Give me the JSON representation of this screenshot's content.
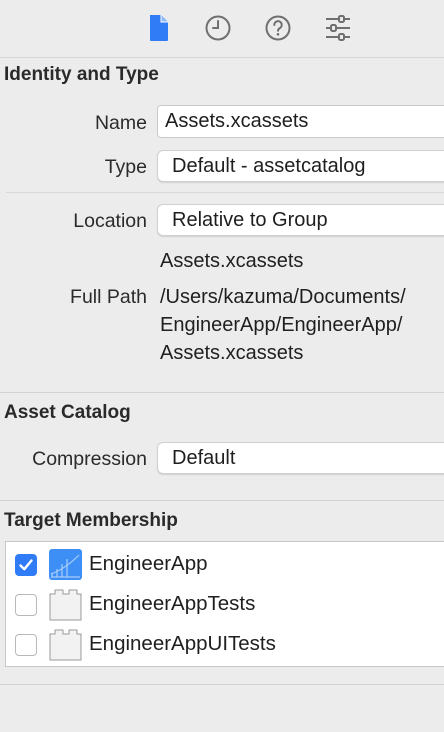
{
  "toolbar": {
    "tabs": [
      {
        "name": "file-inspector",
        "icon": "document-icon",
        "active": true
      },
      {
        "name": "history-inspector",
        "icon": "clock-icon",
        "active": false
      },
      {
        "name": "quick-help",
        "icon": "question-circle-icon",
        "active": false
      },
      {
        "name": "attributes-inspector",
        "icon": "sliders-icon",
        "active": false
      }
    ]
  },
  "identity": {
    "title": "Identity and Type",
    "name_label": "Name",
    "name_value": "Assets.xcassets",
    "type_label": "Type",
    "type_value": "Default - assetcatalog",
    "location_label": "Location",
    "location_value": "Relative to Group",
    "location_filename": "Assets.xcassets",
    "full_path_label": "Full Path",
    "full_path_lines": [
      "/Users/kazuma/Documents/",
      "EngineerApp/EngineerApp/",
      "Assets.xcassets"
    ]
  },
  "asset_catalog": {
    "title": "Asset Catalog",
    "compression_label": "Compression",
    "compression_value": "Default"
  },
  "target_membership": {
    "title": "Target Membership",
    "targets": [
      {
        "label": "EngineerApp",
        "checked": true,
        "icon": "app-target-icon"
      },
      {
        "label": "EngineerAppTests",
        "checked": false,
        "icon": "test-bundle-icon"
      },
      {
        "label": "EngineerAppUITests",
        "checked": false,
        "icon": "test-bundle-icon"
      }
    ]
  },
  "colors": {
    "accent": "#2f7cf6",
    "background": "#ececec"
  }
}
